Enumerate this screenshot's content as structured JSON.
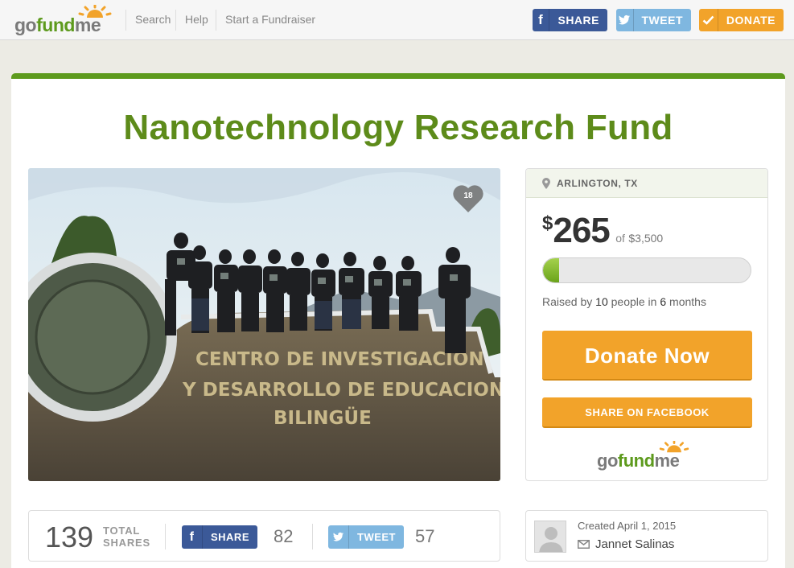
{
  "header": {
    "logo": "gofundme",
    "nav": [
      "Search",
      "Help",
      "Start a Fundraiser"
    ],
    "buttons": {
      "share": "SHARE",
      "tweet": "TWEET",
      "donate": "DONATE"
    }
  },
  "campaign": {
    "title": "Nanotechnology Research Fund",
    "likes": "18",
    "photo_sign": [
      "CENTRO DE INVESTIGACION",
      "Y DESARROLLO DE EDUCACION",
      "BILINGÜE"
    ]
  },
  "panel": {
    "location": "ARLINGTON, TX",
    "currency": "$",
    "raised": "265",
    "of_label": "of",
    "goal": "$3,500",
    "progress_fraction": 0.076,
    "raised_prefix": "Raised by",
    "people": "10",
    "people_label": "people in",
    "months": "6",
    "months_label": "months",
    "donate_now": "Donate Now",
    "share_facebook": "SHARE ON FACEBOOK",
    "logo": "gofundme"
  },
  "shares": {
    "total": "139",
    "total_label_1": "TOTAL",
    "total_label_2": "SHARES",
    "share_label": "SHARE",
    "share_count": "82",
    "tweet_label": "TWEET",
    "tweet_count": "57"
  },
  "creator": {
    "created": "Created April 1, 2015",
    "organizer": "Jannet Salinas"
  },
  "colors": {
    "brand_green": "#5d9a1d",
    "title_green": "#5d8b1a",
    "facebook": "#3b5998",
    "twitter": "#7fb7e0",
    "donate_orange": "#f2a32a"
  },
  "icons": [
    "sun-logo-icon",
    "facebook-icon",
    "twitter-icon",
    "check-icon",
    "heart-icon",
    "location-pin-icon",
    "envelope-icon",
    "avatar-placeholder-icon"
  ]
}
